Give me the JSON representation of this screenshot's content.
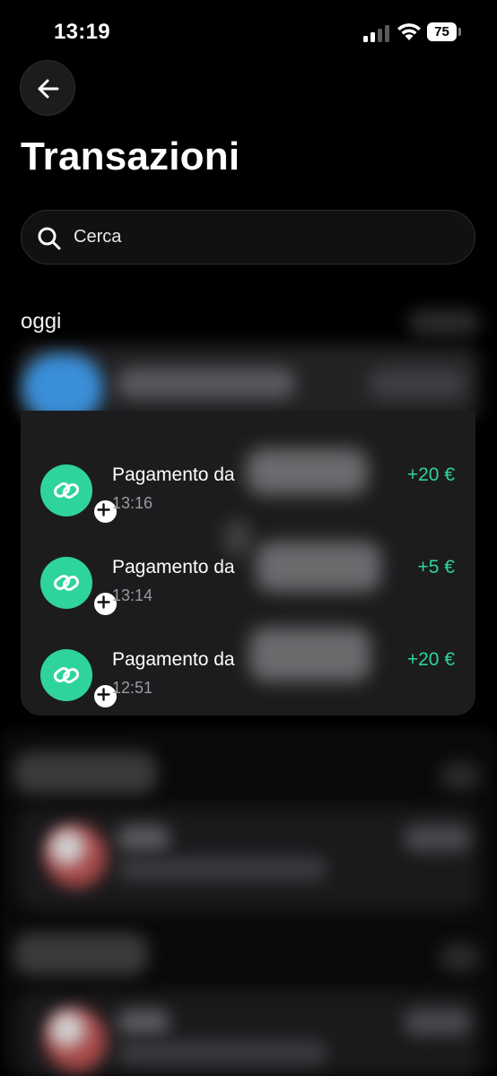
{
  "status_bar": {
    "time": "13:19",
    "battery": "75",
    "icons": [
      "signal-icon",
      "wifi-icon",
      "battery-icon"
    ]
  },
  "header": {
    "back_icon": "arrow-left-icon",
    "title": "Transazioni"
  },
  "search": {
    "placeholder": "Cerca",
    "icon": "search-icon"
  },
  "sections": {
    "today_label": "oggi"
  },
  "transactions": [
    {
      "title": "Pagamento da",
      "time": "13:16",
      "amount": "+20 €",
      "icon": "link-icon"
    },
    {
      "title": "Pagamento da",
      "time": "13:14",
      "amount": "+5 €",
      "icon": "link-icon"
    },
    {
      "title": "Pagamento da",
      "time": "12:51",
      "amount": "+20 €",
      "icon": "link-icon"
    }
  ],
  "colors": {
    "background": "#000000",
    "card": "#1c1c1e",
    "accent_green": "#2fd49a",
    "secondary_text": "#9a9a9e"
  }
}
